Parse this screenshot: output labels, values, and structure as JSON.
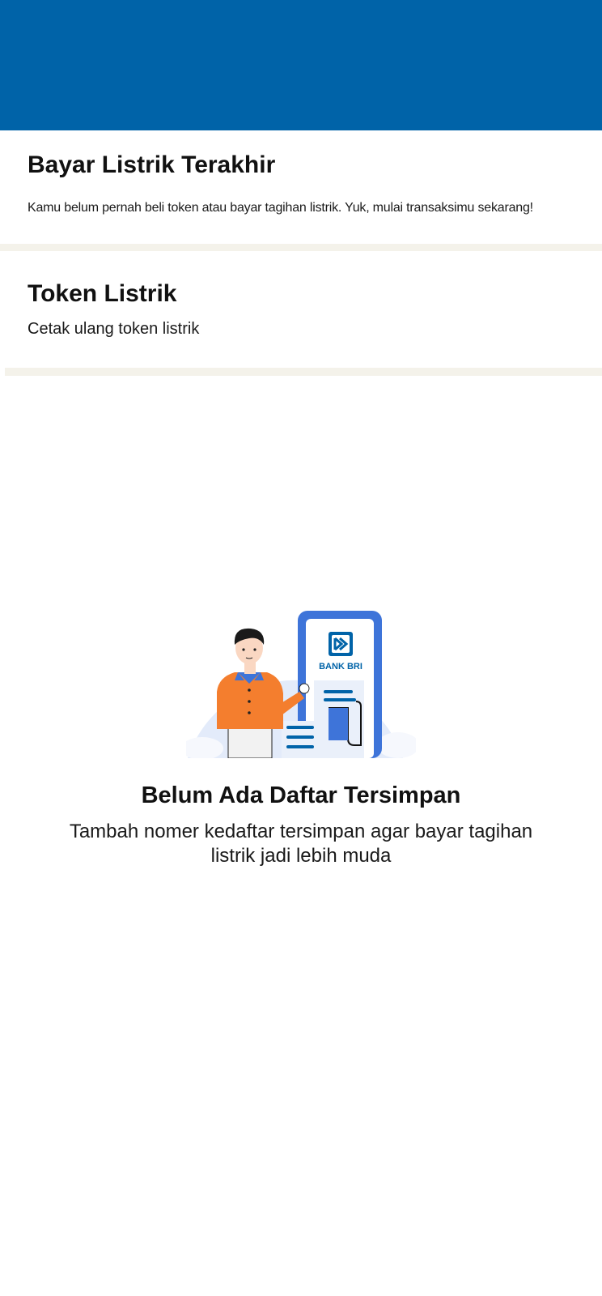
{
  "header": {
    "color": "#0063A8"
  },
  "recent": {
    "title": "Bayar Listrik Terakhir",
    "description": "Kamu belum pernah beli token atau bayar tagihan listrik. Yuk, mulai transaksimu sekarang!"
  },
  "token": {
    "title": "Token Listrik",
    "subtitle": "Cetak ulang token listrik"
  },
  "empty_state": {
    "illustration_icon": "person-with-bank-bri-phone-illustration",
    "logo_text": "BANK BRI",
    "title": "Belum Ada Daftar Tersimpan",
    "description": "Tambah nomer kedaftar tersimpan agar bayar tagihan listrik jadi lebih muda"
  }
}
